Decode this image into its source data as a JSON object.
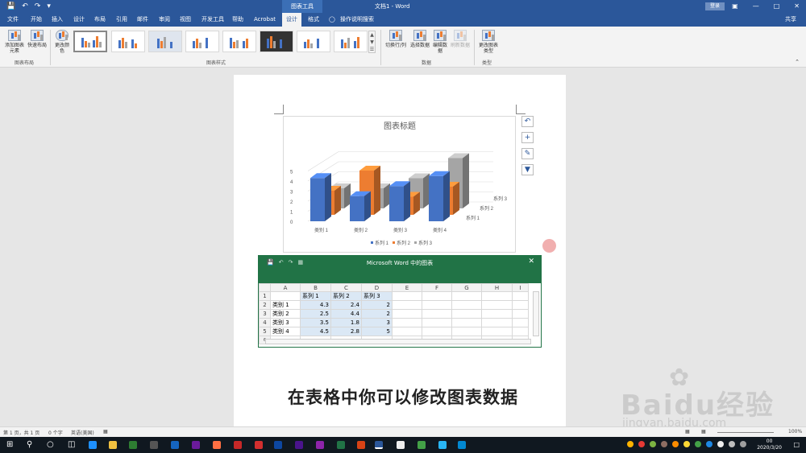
{
  "titlebar": {
    "context_tab": "图表工具",
    "doc_title": "文档1 - Word",
    "login": "登录",
    "save_icon": "save-icon",
    "undo_icon": "undo-icon"
  },
  "tabs": [
    {
      "label": "文件"
    },
    {
      "label": "开始"
    },
    {
      "label": "插入"
    },
    {
      "label": "设计"
    },
    {
      "label": "布局"
    },
    {
      "label": "引用"
    },
    {
      "label": "邮件"
    },
    {
      "label": "审阅"
    },
    {
      "label": "视图"
    },
    {
      "label": "开发工具"
    },
    {
      "label": "帮助"
    },
    {
      "label": "Acrobat"
    },
    {
      "label": "设计"
    },
    {
      "label": "格式"
    }
  ],
  "tell_me": "操作说明搜索",
  "share": "共享",
  "ribbon": {
    "add_element": "添加图表元素",
    "quick_layout": "快速布局",
    "group_layout": "图表布局",
    "change_colors": "更改颜色",
    "group_styles": "图表样式",
    "switch_rowcol": "切换行/列",
    "select_data": "选择数据",
    "edit_data": "编辑数据",
    "refresh_data": "刷新数据",
    "group_data": "数据",
    "change_type": "更改图表类型",
    "group_type": "类型"
  },
  "chart_data": {
    "type": "bar",
    "title": "图表标题",
    "categories": [
      "类别 1",
      "类别 2",
      "类别 3",
      "类别 4"
    ],
    "series": [
      {
        "name": "系列 1",
        "values": [
          4.3,
          2.5,
          3.5,
          4.5
        ],
        "color": "#4472c4"
      },
      {
        "name": "系列 2",
        "values": [
          2.4,
          4.4,
          1.8,
          2.8
        ],
        "color": "#ed7d31"
      },
      {
        "name": "系列 3",
        "values": [
          2,
          2,
          3,
          5
        ],
        "color": "#a5a5a5"
      }
    ],
    "yticks": [
      "0",
      "1",
      "2",
      "3",
      "4",
      "5"
    ],
    "ylim": [
      0,
      5
    ],
    "legend_position": "bottom",
    "grid": true
  },
  "excel": {
    "title": "Microsoft Word 中的图表",
    "columns": [
      "",
      "A",
      "B",
      "C",
      "D",
      "E",
      "F",
      "G",
      "H",
      "I"
    ],
    "rows": [
      {
        "num": "1",
        "cells": [
          "",
          "系列 1",
          "系列 2",
          "系列 3",
          "",
          "",
          "",
          "",
          ""
        ]
      },
      {
        "num": "2",
        "cells": [
          "类别 1",
          "4.3",
          "2.4",
          "2",
          "",
          "",
          "",
          "",
          ""
        ]
      },
      {
        "num": "3",
        "cells": [
          "类别 2",
          "2.5",
          "4.4",
          "2",
          "",
          "",
          "",
          "",
          ""
        ]
      },
      {
        "num": "4",
        "cells": [
          "类别 3",
          "3.5",
          "1.8",
          "3",
          "",
          "",
          "",
          "",
          ""
        ]
      },
      {
        "num": "5",
        "cells": [
          "类别 4",
          "4.5",
          "2.8",
          "5",
          "",
          "",
          "",
          "",
          ""
        ]
      },
      {
        "num": "6",
        "cells": [
          "",
          "",
          "",
          "",
          "",
          "",
          "",
          "",
          ""
        ]
      }
    ]
  },
  "caption": "在表格中你可以修改图表数据",
  "watermark": {
    "brand": "Baidu经验",
    "url": "jingyan.baidu.com"
  },
  "status": {
    "page": "第 1 页，共 1 页",
    "words": "0 个字",
    "lang": "英语(美国)",
    "zoom": "100%"
  },
  "taskbar": {
    "time": "00",
    "date": "2020/3/20"
  }
}
